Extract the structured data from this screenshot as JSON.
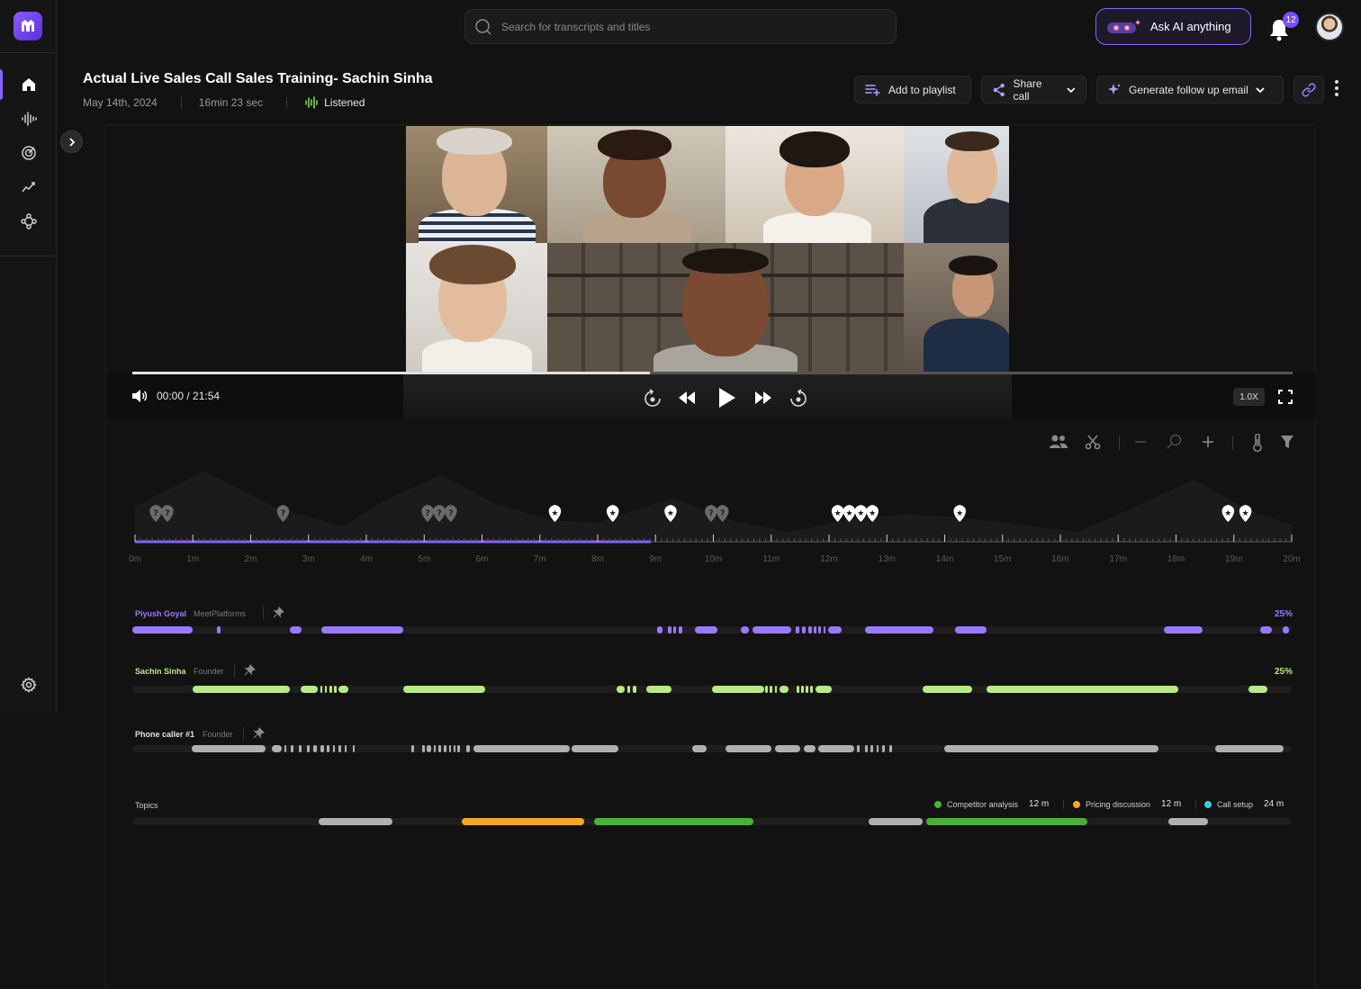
{
  "search": {
    "placeholder": "Search for transcripts and titles"
  },
  "ask_ai": {
    "label": "Ask AI anything"
  },
  "notifications": {
    "count": "12"
  },
  "call": {
    "title": "Actual Live Sales Call Sales Training- Sachin Sinha",
    "date": "May 14th, 2024",
    "duration": "16min 23 sec",
    "status": "Listened"
  },
  "actions": {
    "add_playlist": "Add to playlist",
    "share": "Share call",
    "follow_up": "Generate follow up email"
  },
  "player": {
    "time": "00:00 / 21:54",
    "speed": "1.0X",
    "progress": 0.446
  },
  "timeline": {
    "ticks": [
      "0m",
      "1m",
      "2m",
      "3m",
      "4m",
      "5m",
      "6m",
      "7m",
      "8m",
      "9m",
      "10m",
      "11m",
      "12m",
      "13m",
      "14m",
      "15m",
      "16m",
      "17m",
      "18m",
      "19m",
      "20m"
    ],
    "progress": 0.446,
    "question_markers": [
      0.36,
      0.56,
      2.56,
      5.06,
      5.26,
      5.46,
      9.96,
      10.16
    ],
    "star_markers": [
      7.26,
      8.26,
      9.26,
      12.15,
      12.35,
      12.55,
      12.75,
      14.26,
      18.9,
      19.2
    ]
  },
  "speakers": [
    {
      "name": "Piyush Goyal",
      "role": "MeetPlatforms",
      "percent": "25%",
      "color": "#9a78ff",
      "segments": [
        [
          0,
          5.2
        ],
        [
          7.3,
          7.6
        ],
        [
          13.6,
          14.6
        ],
        [
          16.3,
          23.4
        ],
        [
          45.3,
          45.7
        ],
        [
          46.2,
          46.5
        ],
        [
          46.7,
          46.9
        ],
        [
          47.1,
          47.4
        ],
        [
          48.5,
          50.5
        ],
        [
          52.5,
          53.2
        ],
        [
          53.5,
          56.8
        ],
        [
          57.2,
          57.5
        ],
        [
          57.8,
          58.1
        ],
        [
          58.3,
          58.6
        ],
        [
          58.8,
          59.0
        ],
        [
          59.2,
          59.4
        ],
        [
          59.6,
          59.8
        ],
        [
          60.0,
          61.2
        ],
        [
          63.2,
          69.1
        ],
        [
          71.0,
          73.7
        ],
        [
          89.0,
          92.3
        ],
        [
          97.3,
          98.3
        ],
        [
          99.2,
          99.8
        ]
      ],
      "pct_visible": true
    },
    {
      "name": "Sachin Sinha",
      "role": "Founder",
      "percent": "25%",
      "color": "#b8e986",
      "segments": [
        [
          5.2,
          13.6
        ],
        [
          14.5,
          16.0
        ],
        [
          16.2,
          16.4
        ],
        [
          16.6,
          16.8
        ],
        [
          17.0,
          17.2
        ],
        [
          17.4,
          17.6
        ],
        [
          17.8,
          18.6
        ],
        [
          23.4,
          30.4
        ],
        [
          41.8,
          42.5
        ],
        [
          42.7,
          42.9
        ],
        [
          43.2,
          43.5
        ],
        [
          44.3,
          46.5
        ],
        [
          50.0,
          54.5
        ],
        [
          54.6,
          54.8
        ],
        [
          55.0,
          55.2
        ],
        [
          55.4,
          55.6
        ],
        [
          55.8,
          56.6
        ],
        [
          57.3,
          57.5
        ],
        [
          57.7,
          57.9
        ],
        [
          58.1,
          58.3
        ],
        [
          58.5,
          58.7
        ],
        [
          58.9,
          60.3
        ],
        [
          68.2,
          72.4
        ],
        [
          73.7,
          90.2
        ],
        [
          96.3,
          97.9
        ]
      ],
      "pct_visible": true
    },
    {
      "name": "Phone caller #1",
      "role": "Founder",
      "percent": "",
      "color": "#b0b0b0",
      "segments": [
        [
          5.1,
          11.5
        ],
        [
          12.0,
          12.9
        ],
        [
          13.1,
          13.3
        ],
        [
          13.7,
          13.9
        ],
        [
          14.4,
          14.6
        ],
        [
          15.1,
          15.3
        ],
        [
          15.6,
          15.9
        ],
        [
          16.2,
          16.5
        ],
        [
          16.8,
          17.0
        ],
        [
          17.3,
          17.5
        ],
        [
          17.8,
          18.0
        ],
        [
          18.3,
          18.5
        ],
        [
          19.0,
          19.2
        ],
        [
          24.1,
          24.3
        ],
        [
          25.0,
          25.2
        ],
        [
          25.4,
          25.8
        ],
        [
          26.0,
          26.2
        ],
        [
          26.4,
          26.6
        ],
        [
          26.9,
          27.1
        ],
        [
          27.3,
          27.5
        ],
        [
          27.7,
          27.9
        ],
        [
          28.0,
          28.3
        ],
        [
          28.8,
          29.1
        ],
        [
          29.4,
          37.7
        ],
        [
          37.9,
          41.9
        ],
        [
          48.3,
          49.5
        ],
        [
          51.2,
          55.1
        ],
        [
          55.4,
          57.6
        ],
        [
          57.9,
          58.9
        ],
        [
          59.2,
          62.3
        ],
        [
          62.5,
          62.7
        ],
        [
          63.2,
          63.4
        ],
        [
          63.7,
          63.9
        ],
        [
          64.2,
          64.4
        ],
        [
          64.7,
          64.9
        ],
        [
          65.3,
          65.5
        ],
        [
          70.0,
          88.5
        ],
        [
          93.4,
          99.3
        ]
      ]
    }
  ],
  "topics": {
    "label": "Topics",
    "legend": [
      {
        "name": "Competitor analysis",
        "duration": "12 m",
        "color": "#4caf3a"
      },
      {
        "name": "Pricing discussion",
        "duration": "12 m",
        "color": "#f5a623"
      },
      {
        "name": "Call setup",
        "duration": "24 m",
        "color": "#3fc9e0"
      }
    ],
    "segments": [
      {
        "start": 16.1,
        "end": 22.4,
        "color": "#b0b0b0"
      },
      {
        "start": 28.4,
        "end": 39.0,
        "color": "#f5a623"
      },
      {
        "start": 39.8,
        "end": 53.6,
        "color": "#4caf3a"
      },
      {
        "start": 63.5,
        "end": 68.2,
        "color": "#b0b0b0"
      },
      {
        "start": 68.5,
        "end": 82.4,
        "color": "#4caf3a"
      },
      {
        "start": 89.4,
        "end": 92.8,
        "color": "#b0b0b0"
      }
    ]
  }
}
